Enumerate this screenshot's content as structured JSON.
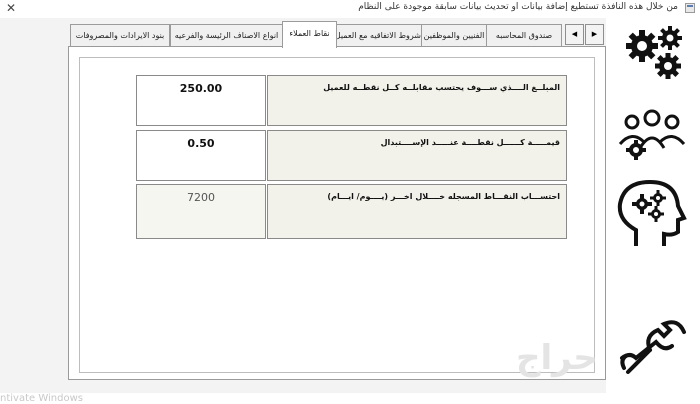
{
  "window": {
    "title": "من خلال هذه النافذة تستطيع إضافة بيانات او تحديث بيانات سابقة موجودة على النظام",
    "close_symbol": "✕"
  },
  "tabs": [
    {
      "label": "صندوق المحاسبه"
    },
    {
      "label": "الفنيين والموظفين"
    },
    {
      "label": "شروط الاتفاقيه مع العميل"
    },
    {
      "label": "نقاط العملاء",
      "active": true
    },
    {
      "label": "انواع الاصناف الرئيسة والفرعيه"
    },
    {
      "label": "بنود الايرادات والمصروفات"
    }
  ],
  "tab_scroll": {
    "left": "◀",
    "right": "▶"
  },
  "fields": [
    {
      "label": "المبلــغ الــــذي ســـوف يحتسب مقابلــه كــل نقطــه للعميل",
      "value": "250.00"
    },
    {
      "label": "قيمـــــة كــــــل نقطــــة عنـــــد الإســــتبدال",
      "value": "0.50"
    },
    {
      "label": "احتســـاب النقـــاط المسجله خــــلال اخـــر (يــــوم/ ايـــام)",
      "value": "7200"
    }
  ],
  "sidebar": {
    "items": [
      "gears-icon",
      "team-settings-icon",
      "head-gears-icon",
      "tools-icon"
    ]
  },
  "watermarks": {
    "windows_activation": "ntivate Windows",
    "site": "حراج"
  }
}
